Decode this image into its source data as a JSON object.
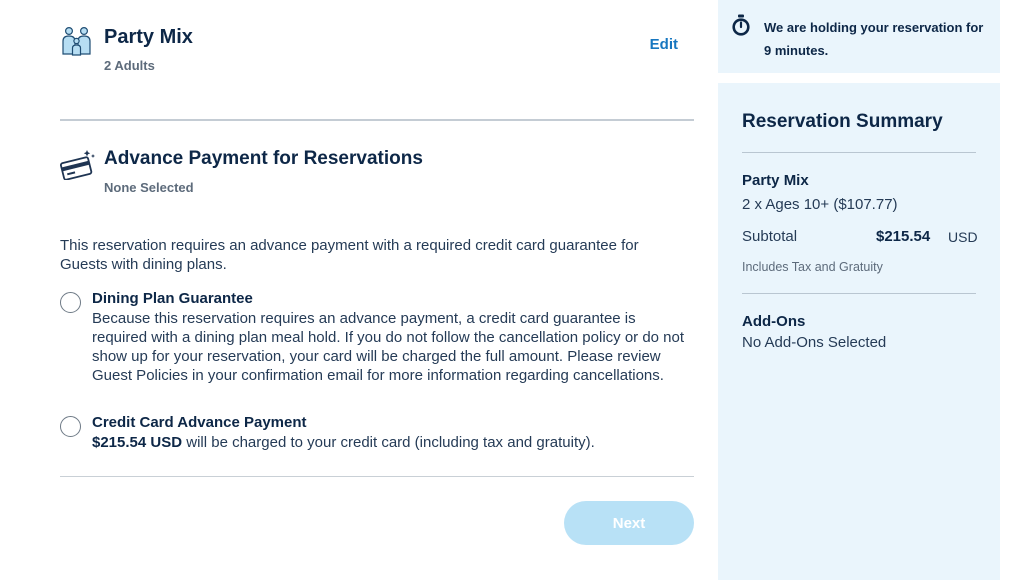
{
  "party": {
    "title": "Party Mix",
    "subtitle": "2 Adults",
    "edit_label": "Edit",
    "icon": "family-icon"
  },
  "advance_payment": {
    "title": "Advance Payment for Reservations",
    "status": "None Selected",
    "icon": "credit-card-icon",
    "intro": "This reservation requires an advance payment with a required credit card guarantee for Guests with dining plans.",
    "options": [
      {
        "title": "Dining Plan Guarantee",
        "description": "Because this reservation requires an advance payment, a credit card guarantee is required with a dining plan meal hold. If you do not follow the cancellation policy or do not show up for your reservation, your card will be charged the full amount. Please review Guest Policies in your confirmation email for more information regarding cancellations.",
        "selected": false
      },
      {
        "title": "Credit Card Advance Payment",
        "amount": "$215.54 USD",
        "description_suffix": " will be charged to your credit card (including tax and gratuity).",
        "selected": false
      }
    ],
    "next_label": "Next"
  },
  "hold_notice": {
    "text": "We are holding your reservation for 9 minutes.",
    "icon": "timer-icon"
  },
  "summary": {
    "title": "Reservation Summary",
    "party_name": "Party Mix",
    "ages_line": "2 x Ages 10+ ($107.77)",
    "subtotal_label": "Subtotal",
    "subtotal_value": "$215.54",
    "currency": "USD",
    "tax_note": "Includes Tax and Gratuity",
    "addons_title": "Add-Ons",
    "addons_value": "No Add-Ons Selected"
  },
  "colors": {
    "brand_blue": "#1777c0",
    "panel_bg": "#eaf5fc",
    "button_disabled": "#b8e1f6",
    "heading": "#0d2747"
  }
}
